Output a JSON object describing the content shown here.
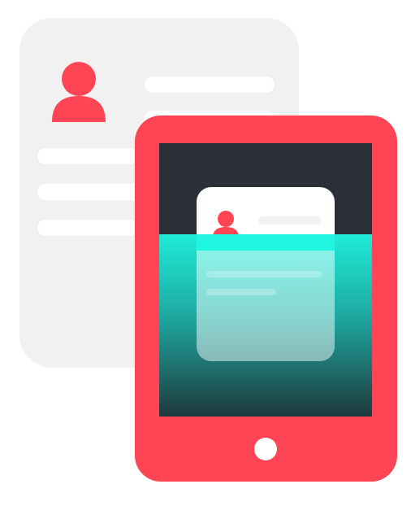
{
  "illustration": {
    "subject": "document-scan-on-tablet",
    "icons": [
      "profile-document-icon",
      "tablet-icon",
      "person-icon",
      "scan-beam-icon",
      "home-button-icon"
    ]
  },
  "colors": {
    "document_bg": "#F1F1F1",
    "document_line": "#FFFFFF",
    "accent_red": "#FF4555",
    "tablet_screen": "#2B2F38",
    "scan_cyan": "#1FF5DF",
    "scan_teal_dark": "#1E3A3D",
    "page_bg": "#FFFFFF"
  }
}
